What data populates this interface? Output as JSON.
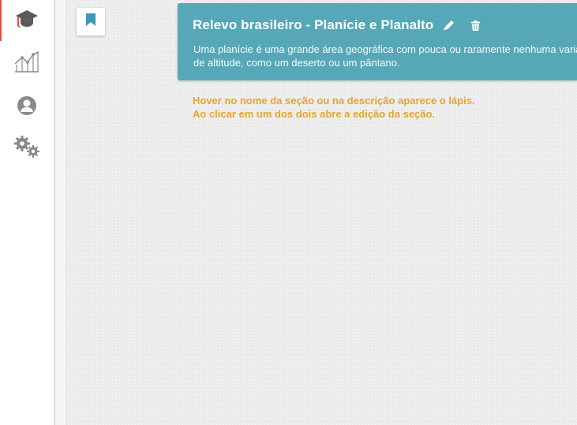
{
  "sidebar": {
    "items": [
      {
        "icon": "graduation-cap-icon",
        "active": true
      },
      {
        "icon": "line-chart-icon",
        "active": false
      },
      {
        "icon": "user-icon",
        "active": false
      },
      {
        "icon": "gears-icon",
        "active": false
      }
    ],
    "accent_color": "#e74c3c"
  },
  "toolbar": {
    "bookmark_icon": "bookmark-icon"
  },
  "section": {
    "title": "Relevo brasileiro - Planície e Planalto",
    "description": "Uma planície é uma grande área geográfica com pouca ou raramente nenhuma variação de altitude, como um deserto ou um pântano.",
    "card_color": "#56a8b8",
    "edit_icon": "pencil-icon",
    "delete_icon": "trash-icon"
  },
  "hint": {
    "line1": "Hover no nome da seção ou na descrição aparece o lápis.",
    "line2": "Ao clicar em um dos dois abre a edição da seção.",
    "color": "#e6a31e"
  }
}
